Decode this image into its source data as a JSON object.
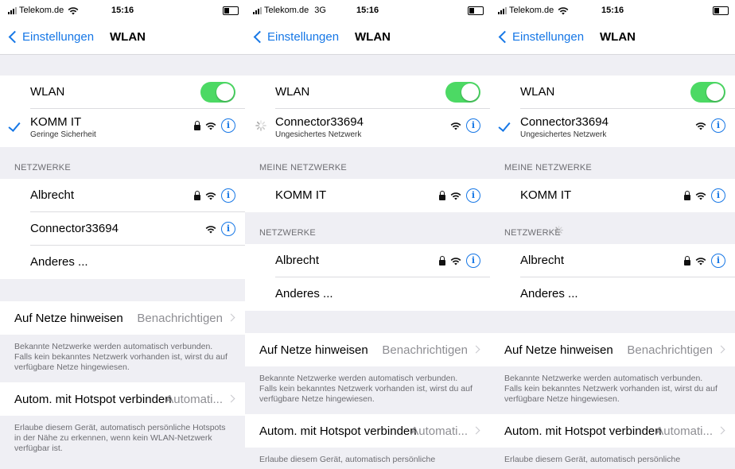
{
  "screens": [
    {
      "status": {
        "carrier": "Telekom.de",
        "network": "",
        "time": "15:16"
      },
      "nav": {
        "back": "Einstellungen",
        "title": "WLAN"
      },
      "wlan": {
        "label": "WLAN",
        "on": true
      },
      "current": {
        "name": "KOMM IT",
        "sub": "Geringe Sicherheit",
        "state": "check",
        "lock": true
      },
      "sections": [
        {
          "header": "NETZWERKE",
          "spinner": false,
          "items": [
            {
              "name": "Albrecht",
              "lock": true,
              "info": true
            },
            {
              "name": "Connector33694",
              "lock": false,
              "info": true
            },
            {
              "name": "Anderes ...",
              "lock": false,
              "info": false
            }
          ]
        }
      ],
      "settings": [
        {
          "label": "Auf Netze hinweisen",
          "value": "Benachrichtigen",
          "footer": "Bekannte Netzwerke werden automatisch verbunden. Falls kein bekanntes Netzwerk vorhanden ist, wirst du auf verfügbare Netze hingewiesen."
        },
        {
          "label": "Autom. mit Hotspot verbinden",
          "value": "Automati...",
          "footer": "Erlaube diesem Gerät, automatisch persönliche Hotspots in der Nähe zu erkennen, wenn kein WLAN-Netzwerk verfügbar ist."
        }
      ]
    },
    {
      "status": {
        "carrier": "Telekom.de",
        "network": "3G",
        "time": "15:16"
      },
      "nav": {
        "back": "Einstellungen",
        "title": "WLAN"
      },
      "wlan": {
        "label": "WLAN",
        "on": true
      },
      "current": {
        "name": "Connector33694",
        "sub": "Ungesichertes Netzwerk",
        "state": "spinner",
        "lock": false
      },
      "sections": [
        {
          "header": "MEINE NETZWERKE",
          "spinner": false,
          "items": [
            {
              "name": "KOMM IT",
              "lock": true,
              "info": true
            }
          ]
        },
        {
          "header": "NETZWERKE",
          "spinner": false,
          "items": [
            {
              "name": "Albrecht",
              "lock": true,
              "info": true
            },
            {
              "name": "Anderes ...",
              "lock": false,
              "info": false
            }
          ]
        }
      ],
      "settings": [
        {
          "label": "Auf Netze hinweisen",
          "value": "Benachrichtigen",
          "footer": "Bekannte Netzwerke werden automatisch verbunden. Falls kein bekanntes Netzwerk vorhanden ist, wirst du auf verfügbare Netze hingewiesen."
        },
        {
          "label": "Autom. mit Hotspot verbinden",
          "value": "Automati...",
          "footer": "Erlaube diesem Gerät, automatisch persönliche"
        }
      ]
    },
    {
      "status": {
        "carrier": "Telekom.de",
        "network": "",
        "time": "15:16"
      },
      "nav": {
        "back": "Einstellungen",
        "title": "WLAN"
      },
      "wlan": {
        "label": "WLAN",
        "on": true
      },
      "current": {
        "name": "Connector33694",
        "sub": "Ungesichertes Netzwerk",
        "state": "check",
        "lock": false
      },
      "sections": [
        {
          "header": "MEINE NETZWERKE",
          "spinner": false,
          "items": [
            {
              "name": "KOMM IT",
              "lock": true,
              "info": true
            }
          ]
        },
        {
          "header": "NETZWERKE",
          "spinner": true,
          "items": [
            {
              "name": "Albrecht",
              "lock": true,
              "info": true
            },
            {
              "name": "Anderes ...",
              "lock": false,
              "info": false
            }
          ]
        }
      ],
      "settings": [
        {
          "label": "Auf Netze hinweisen",
          "value": "Benachrichtigen",
          "footer": "Bekannte Netzwerke werden automatisch verbunden. Falls kein bekanntes Netzwerk vorhanden ist, wirst du auf verfügbare Netze hingewiesen."
        },
        {
          "label": "Autom. mit Hotspot verbinden",
          "value": "Automati...",
          "footer": "Erlaube diesem Gerät, automatisch persönliche"
        }
      ]
    }
  ],
  "colors": {
    "accent": "#1677e6",
    "toggle_on": "#4cd964",
    "group_bg": "#efeff4"
  },
  "icons": {
    "lock": "lock-icon",
    "wifi": "wifi-icon",
    "info": "info-icon",
    "check": "checkmark-icon",
    "spinner": "spinner-icon",
    "back": "chevron-left-icon",
    "disclosure": "chevron-right-icon"
  }
}
